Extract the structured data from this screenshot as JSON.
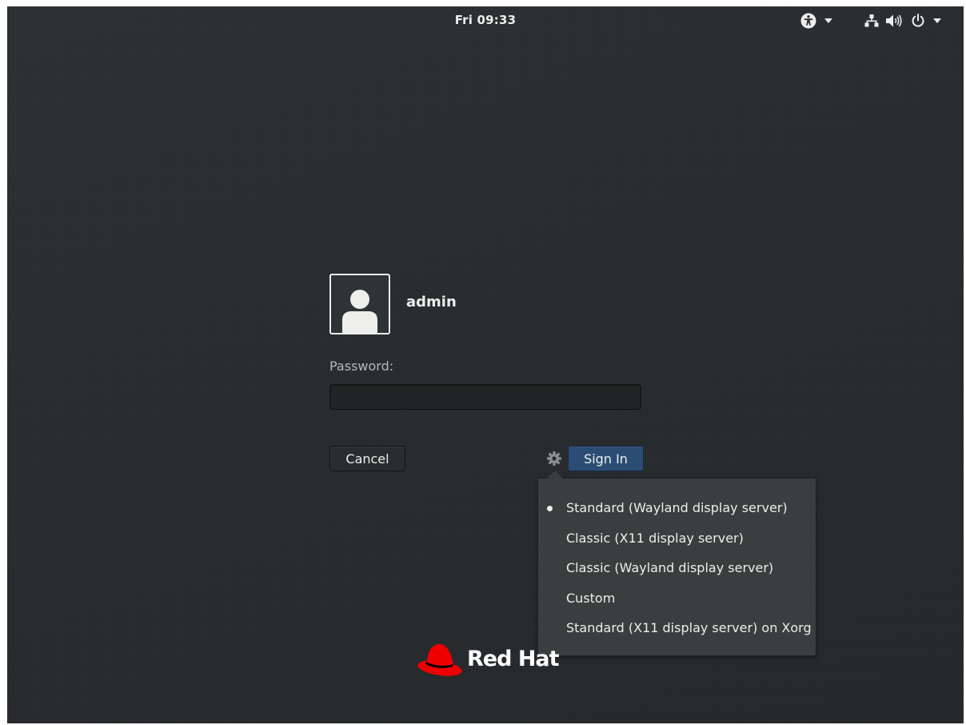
{
  "top_bar": {
    "clock": "Fri 09:33",
    "icons": [
      "accessibility-icon",
      "network-icon",
      "volume-icon",
      "power-icon"
    ]
  },
  "login": {
    "username": "admin",
    "password_label": "Password:",
    "password_value": "",
    "cancel_label": "Cancel",
    "sign_in_label": "Sign In"
  },
  "session_menu": {
    "selected_index": 0,
    "items": [
      "Standard (Wayland display server)",
      "Classic (X11 display server)",
      "Classic (Wayland display server)",
      "Custom",
      "Standard (X11 display server) on Xorg"
    ]
  },
  "logo": {
    "text": "Red Hat"
  },
  "colors": {
    "background": "#2a2d2f",
    "accent": "#2b4d74",
    "brand_red": "#ee0000",
    "text": "#eeeeec"
  }
}
